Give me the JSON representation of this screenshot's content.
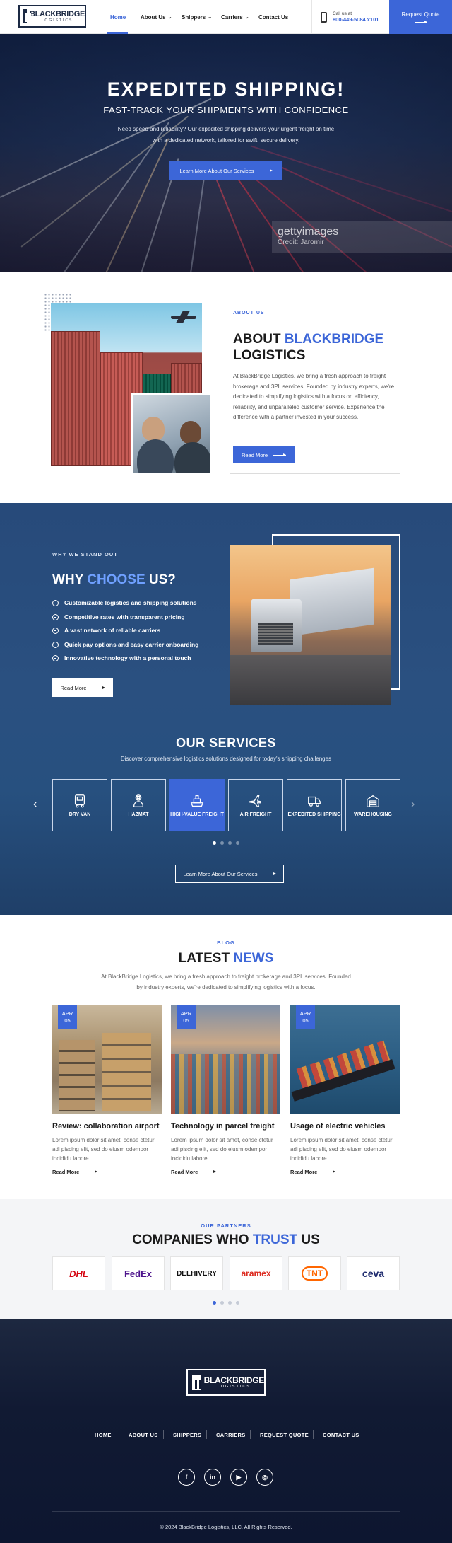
{
  "header": {
    "logo_main": "BLACKBRIDGE",
    "logo_sub": "LOGISTICS",
    "nav": [
      "Home",
      "About Us",
      "Shippers",
      "Carriers",
      "Contact Us"
    ],
    "call_label": "Call us at",
    "call_number": "800-449-5084 x101",
    "quote_label": "Request Quote"
  },
  "hero": {
    "title": "EXPEDITED SHIPPING!",
    "subtitle": "FAST-TRACK YOUR SHIPMENTS WITH CONFIDENCE",
    "text": "Need speed and reliability? Our expedited shipping delivers your urgent freight on time with a dedicated network, tailored for swift, secure delivery.",
    "button": "Learn More About Our Services",
    "watermark": "gettyimages",
    "credit": "Credit: Jaromir"
  },
  "about": {
    "label": "ABOUT US",
    "heading_a": "ABOUT ",
    "heading_b": "BLACKBRIDGE",
    "heading_c": "LOGISTICS",
    "text": "At BlackBridge Logistics, we bring a fresh approach to freight brokerage and 3PL services. Founded by industry experts, we're dedicated to simplifying logistics with a focus on efficiency, reliability, and unparalleled customer service. Experience the difference with a partner invested in your success.",
    "button": "Read More"
  },
  "why": {
    "label": "WHY WE STAND OUT",
    "heading_a": "WHY ",
    "heading_b": "CHOOSE",
    "heading_c": " US?",
    "items": [
      "Customizable logistics and shipping solutions",
      "Competitive rates with transparent pricing",
      "A vast network of reliable carriers",
      "Quick pay options and easy carrier onboarding",
      "Innovative technology with a personal touch"
    ],
    "button": "Read More"
  },
  "services": {
    "heading": "OUR SERVICES",
    "subtitle": "Discover comprehensive logistics solutions designed for today's shipping challenges",
    "items": [
      "DRY VAN",
      "HAZMAT",
      "HIGH-VALUE FREIGHT",
      "AIR FREIGHT",
      "EXPEDITED SHIPPING",
      "WAREHOUSING"
    ],
    "button": "Learn More About Our Services",
    "prev_icon": "‹",
    "next_icon": "›"
  },
  "blog": {
    "label": "BLOG",
    "heading_a": "LATEST ",
    "heading_b": "NEWS",
    "text": "At BlackBridge Logistics, we bring a fresh approach to freight brokerage and 3PL services. Founded by industry experts, we're dedicated to simplifying logistics with a focus.",
    "posts": [
      {
        "month": "APR",
        "day": "05",
        "title": "Review: collaboration airport",
        "text": "Lorem ipsum dolor sit amet, conse ctetur adi piscing elit, sed do eiusm odempor incididu labore.",
        "link": "Read More"
      },
      {
        "month": "APR",
        "day": "05",
        "title": "Technology in parcel freight",
        "text": "Lorem ipsum dolor sit amet, conse ctetur adi piscing elit, sed do eiusm odempor incididu labore.",
        "link": "Read More"
      },
      {
        "month": "APR",
        "day": "05",
        "title": "Usage of electric vehicles",
        "text": "Lorem ipsum dolor sit amet, conse ctetur adi piscing elit, sed do eiusm odempor incididu labore.",
        "link": "Read More"
      }
    ]
  },
  "partners": {
    "label": "OUR PARTNERS",
    "heading_a": "COMPANIES WHO ",
    "heading_b": "TRUST",
    "heading_c": " US",
    "logos": [
      "DHL",
      "FedEx",
      "DELHIVERY",
      "aramex",
      "TNT",
      "ceva"
    ]
  },
  "footer": {
    "logo_main": "BLACKBRIDGE",
    "logo_sub": "LOGISTICS",
    "nav": [
      "HOME",
      "ABOUT US",
      "SHIPPERS",
      "CARRIERS",
      "REQUEST QUOTE",
      "CONTACT US"
    ],
    "social": [
      "f",
      "in",
      "▶",
      "◎"
    ],
    "copyright": "© 2024 BlackBridge Logistics, LLC. All Rights Reserved."
  },
  "colors": {
    "accent": "#3c66d8",
    "dark_navy": "#111a33",
    "section_blue": "#27507f"
  }
}
